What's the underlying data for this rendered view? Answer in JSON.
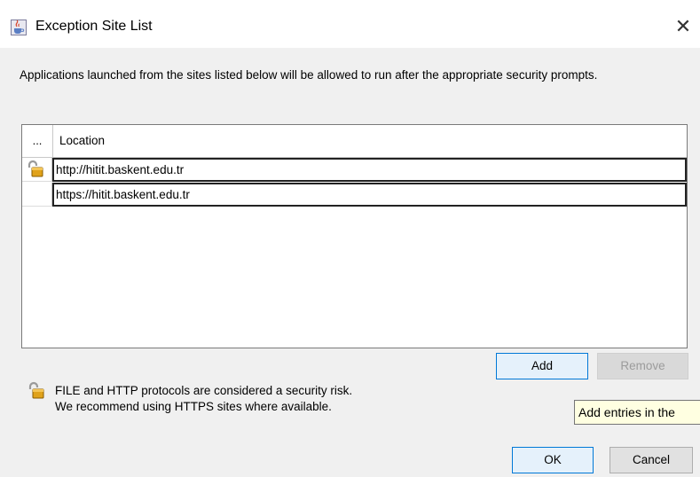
{
  "window": {
    "title": "Exception Site List",
    "icon": "java-cup-icon",
    "close_glyph": "✕"
  },
  "description": "Applications launched from the sites listed below will be allowed to run after the appropriate security prompts.",
  "table": {
    "columns": [
      "...",
      "Location"
    ],
    "rows": [
      {
        "icon": "lock-icon",
        "location": "http://hitit.baskent.edu.tr"
      },
      {
        "icon": "",
        "location": "https://hitit.baskent.edu.tr"
      }
    ]
  },
  "buttons": {
    "add": "Add",
    "remove": "Remove",
    "ok": "OK",
    "cancel": "Cancel"
  },
  "warning": {
    "icon": "lock-icon",
    "line1": "FILE and HTTP protocols are considered a security risk.",
    "line2": "We recommend using HTTPS sites where available."
  },
  "tooltip": "Add entries in the"
}
